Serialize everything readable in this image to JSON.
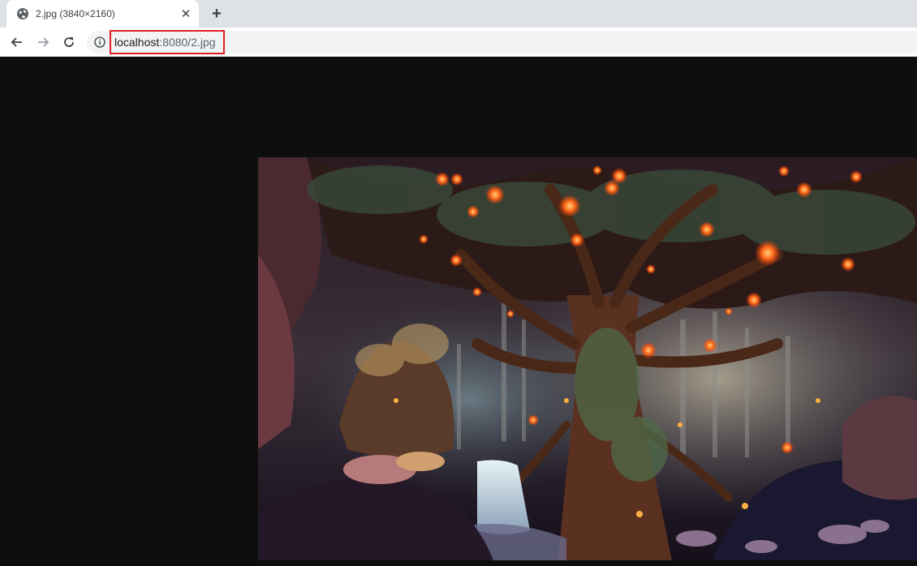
{
  "tab": {
    "title": "2.jpg (3840×2160)",
    "close_label": "✕",
    "favicon": "globe-icon"
  },
  "new_tab_label": "+",
  "toolbar": {
    "back_icon": "arrow-left-icon",
    "forward_icon": "arrow-right-icon",
    "reload_icon": "reload-icon",
    "info_icon": "info-icon"
  },
  "address": {
    "host": "localhost",
    "path": ":8080/2.jpg"
  },
  "image": {
    "subject": "fantasy forest with glowing giant tree and waterfall",
    "highlight_color": "#e02020"
  }
}
